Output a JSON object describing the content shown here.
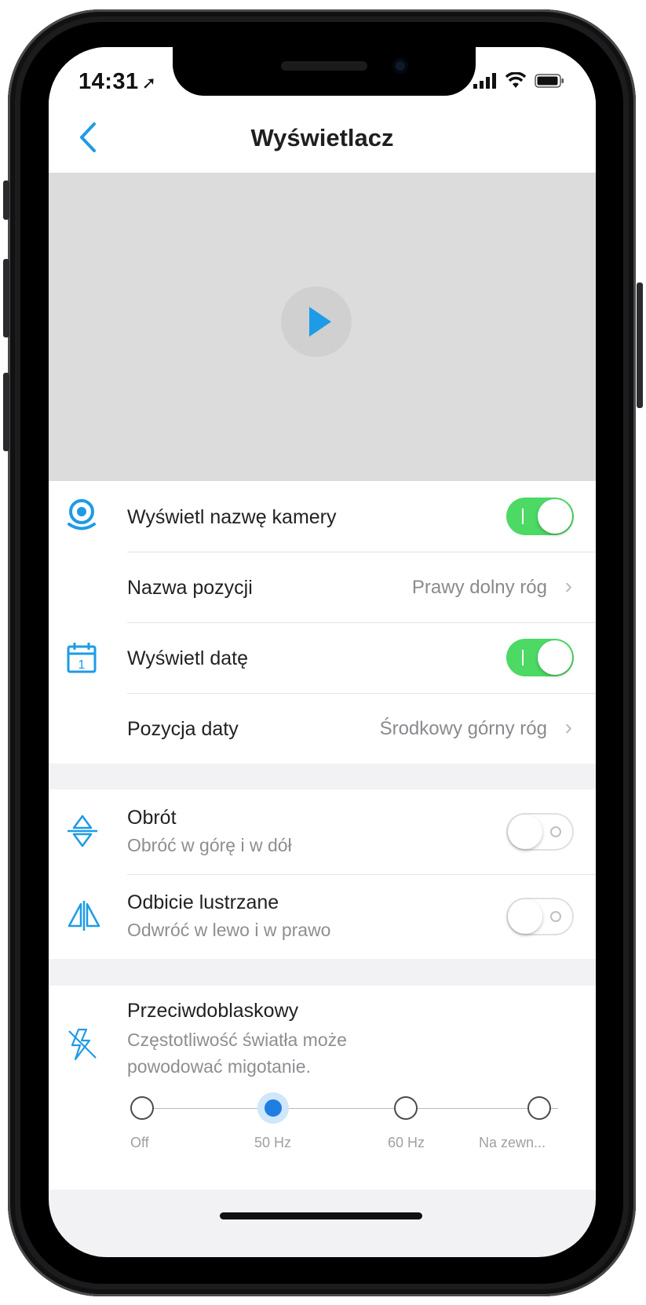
{
  "status": {
    "time": "14:31"
  },
  "nav": {
    "title": "Wyświetlacz"
  },
  "display": {
    "camera_name": {
      "label": "Wyświetl nazwę kamery",
      "enabled": true
    },
    "name_position": {
      "label": "Nazwa pozycji",
      "value": "Prawy dolny róg"
    },
    "date": {
      "label": "Wyświetl datę",
      "enabled": true
    },
    "date_position": {
      "label": "Pozycja daty",
      "value": "Środkowy górny róg"
    }
  },
  "orientation": {
    "rotate": {
      "label": "Obrót",
      "subtitle": "Obróć w górę i w dół",
      "enabled": false
    },
    "mirror": {
      "label": "Odbicie lustrzane",
      "subtitle": "Odwróć w lewo i w prawo",
      "enabled": false
    }
  },
  "antiflicker": {
    "label": "Przeciwdoblaskowy",
    "subtitle_line1": "Częstotliwość światła może",
    "subtitle_line2": "powodować migotanie.",
    "options": [
      "Off",
      "50 Hz",
      "60 Hz",
      "Na zewn..."
    ],
    "selected": "50 Hz"
  },
  "colors": {
    "accent": "#1e9be6",
    "toggle_on": "#4cd964"
  }
}
